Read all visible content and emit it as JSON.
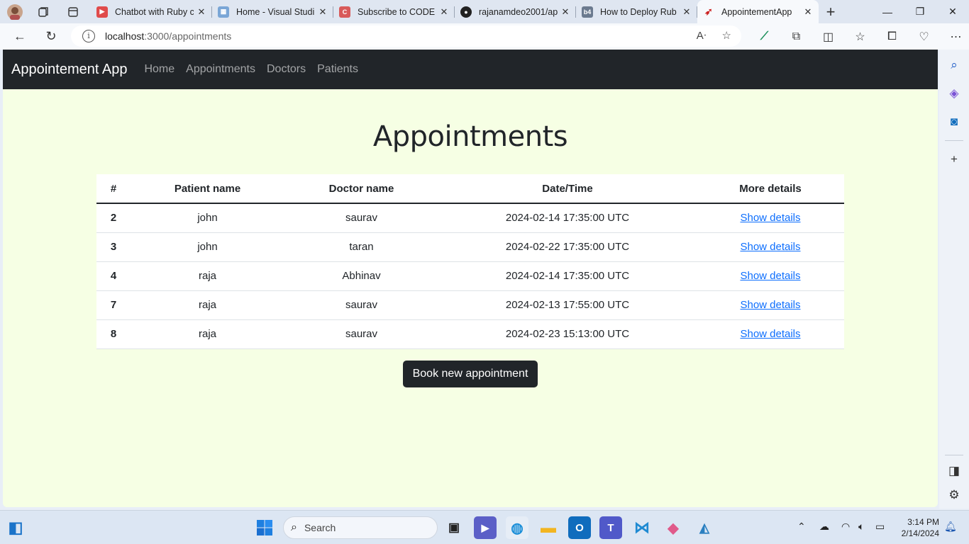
{
  "browser": {
    "tabs": [
      {
        "title": "Chatbot with Ruby c",
        "favicon_color": "#e04b4b",
        "favicon": "youtube-icon"
      },
      {
        "title": "Home - Visual Studi",
        "favicon_color": "#7aa6d6",
        "favicon": "microsoft-icon"
      },
      {
        "title": "Subscribe to CODE I",
        "favicon_color": "#d85a5a",
        "favicon": "code-icon"
      },
      {
        "title": "rajanamdeo2001/ap",
        "favicon_color": "#222222",
        "favicon": "github-icon"
      },
      {
        "title": "How to Deploy Rub",
        "favicon_color": "#6b7a8f",
        "favicon": "b4a-icon"
      },
      {
        "title": "AppointementApp",
        "favicon_color": "#cc2222",
        "favicon": "rails-icon"
      }
    ],
    "url_host": "localhost",
    "url_rest": ":3000/appointments"
  },
  "app": {
    "brand": "Appointement App",
    "nav": [
      "Home",
      "Appointments",
      "Doctors",
      "Patients"
    ],
    "heading": "Appointments",
    "table": {
      "headers": [
        "#",
        "Patient name",
        "Doctor name",
        "Date/Time",
        "More details"
      ],
      "rows": [
        {
          "id": "2",
          "patient": "john",
          "doctor": "saurav",
          "datetime": "2024-02-14 17:35:00 UTC",
          "link": "Show details"
        },
        {
          "id": "3",
          "patient": "john",
          "doctor": "taran",
          "datetime": "2024-02-22 17:35:00 UTC",
          "link": "Show details"
        },
        {
          "id": "4",
          "patient": "raja",
          "doctor": "Abhinav",
          "datetime": "2024-02-14 17:35:00 UTC",
          "link": "Show details"
        },
        {
          "id": "7",
          "patient": "raja",
          "doctor": "saurav",
          "datetime": "2024-02-13 17:55:00 UTC",
          "link": "Show details"
        },
        {
          "id": "8",
          "patient": "raja",
          "doctor": "saurav",
          "datetime": "2024-02-23 15:13:00 UTC",
          "link": "Show details"
        }
      ]
    },
    "book_button": "Book new appointment"
  },
  "taskbar": {
    "search_placeholder": "Search",
    "time": "3:14 PM",
    "date": "2/14/2024"
  },
  "colors": {
    "page_bg": "#f6ffe4",
    "navbar_bg": "#212529",
    "link": "#0d6efd"
  }
}
